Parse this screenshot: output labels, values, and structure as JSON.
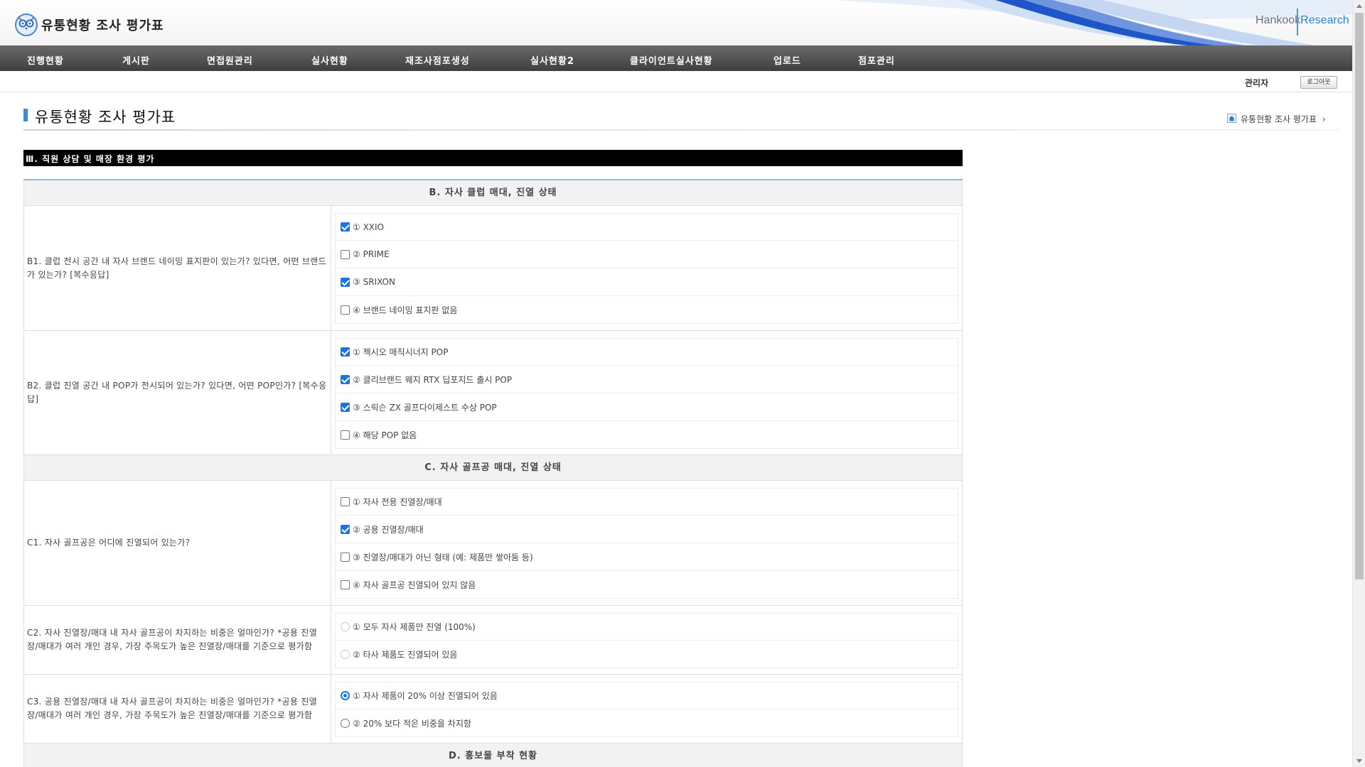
{
  "header": {
    "site_title": "유통현황 조사 평가표",
    "brand_part1": "Hankook",
    "brand_part2": "Research"
  },
  "nav": [
    "진행현황",
    "게시판",
    "면접원관리",
    "실사현황",
    "재조사점포생성",
    "실사현황2",
    "클라이언트실사현황",
    "업로드",
    "점포관리"
  ],
  "util": {
    "user": "관리자",
    "logout": "로그아웃"
  },
  "page": {
    "title": "유통현황 조사 평가표",
    "breadcrumb": "유통현황 조사 평가표"
  },
  "section": "Ⅲ. 직원 상담 및 매장 환경 평가",
  "groups": {
    "b": "B. 자사 클럽 매대, 진열 상태",
    "c": "C. 자사 골프공 매대, 진열 상태",
    "d": "D. 홍보물 부착 현황"
  },
  "questions": {
    "b1": {
      "text": "B1. 클럽 전시 공간 내 자사 브랜드 네이밍 표지판이 있는가? 있다면, 어떤 브랜드가 있는가? [복수응답]",
      "options": [
        "① XXIO",
        "② PRIME",
        "③ SRIXON",
        "④ 브랜드 네이밍 표지판 없음"
      ],
      "checked": [
        true,
        false,
        true,
        false
      ]
    },
    "b2": {
      "text": "B2. 클럽 진열 공간 내 POP가 전시되어 있는가? 있다면, 어떤 POP인가? [복수응답]",
      "options": [
        "① 젝시오 매직시너지 POP",
        "② 클리브랜드 웨지 RTX 딥포지드 출시 POP",
        "③ 스릭슨 ZX 골프다이제스트 수상 POP",
        "④ 해당 POP 없음"
      ],
      "checked": [
        true,
        true,
        true,
        false
      ]
    },
    "c1": {
      "text": "C1. 자사 골프공은 어디에 진열되어 있는가?",
      "options": [
        "① 자사 전용 진열장/매대",
        "② 공용 진열장/매대",
        "③ 진열장/매대가 아닌 형태 (예: 제품만 쌓아둠 등)",
        "④ 자사 골프공 진열되어 있지 않음"
      ],
      "checked": [
        false,
        true,
        false,
        false
      ]
    },
    "c2": {
      "text": "C2. 자사 진열장/매대 내 자사 골프공이 차지하는 비중은 얼마인가? *공용 진열장/매대가 여러 개인 경우, 가장 주목도가 높은 진열장/매대를 기준으로 평가함",
      "options": [
        "① 모두 자사 제품만 진열 (100%)",
        "② 타사 제품도 진열되어 있음"
      ],
      "selected": null
    },
    "c3": {
      "text": "C3. 공용 진열장/매대 내 자사 골프공이 차지하는 비중은 얼마인가? *공용 진열장/매대가 여러 개인 경우, 가장 주목도가 높은 진열장/매대를 기준으로 평가함",
      "options": [
        "① 자사 제품이 20% 이상 진열되어 있음",
        "② 20% 보다 적은 비중을 차지함"
      ],
      "selected": 0
    }
  }
}
